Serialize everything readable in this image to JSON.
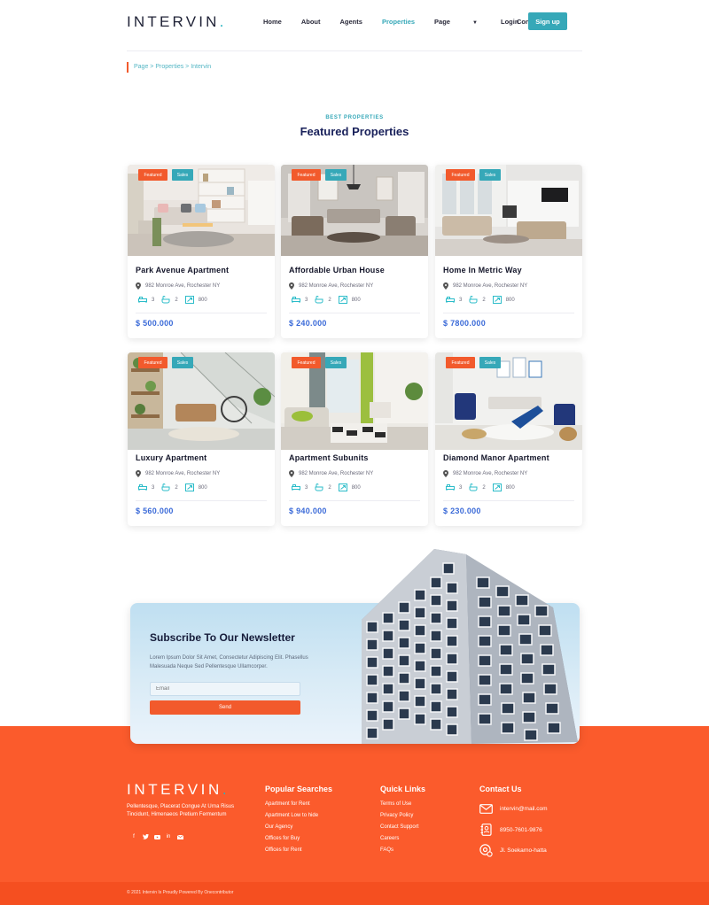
{
  "header": {
    "logo": "INTERVIN",
    "logo_dot": ".",
    "nav": [
      "Home",
      "About",
      "Agents",
      "Properties",
      "Page",
      "Contact Us"
    ],
    "active_nav": "Properties",
    "login": "Login",
    "signup": "Sign up"
  },
  "breadcrumb": "Page > Properties > Intervin",
  "section": {
    "eyebrow": "BEST PROPERTIES",
    "title": "Featured Properties"
  },
  "tags": {
    "featured": "Featured",
    "sales": "Sales"
  },
  "properties": [
    {
      "name": "Park Avenue Apartment",
      "address": "982 Monroe Ave, Rochester NY",
      "beds": "3",
      "baths": "2",
      "area": "800",
      "price": "$ 500.000"
    },
    {
      "name": "Affordable Urban House",
      "address": "982 Monroe Ave, Rochester NY",
      "beds": "3",
      "baths": "2",
      "area": "800",
      "price": "$ 240.000"
    },
    {
      "name": "Home In Metric Way",
      "address": "982 Monroe Ave, Rochester NY",
      "beds": "3",
      "baths": "2",
      "area": "800",
      "price": "$ 7800.000"
    },
    {
      "name": "Luxury Apartment",
      "address": "982 Monroe Ave, Rochester NY",
      "beds": "3",
      "baths": "2",
      "area": "800",
      "price": "$ 560.000"
    },
    {
      "name": "Apartment Subunits",
      "address": "982 Monroe Ave, Rochester NY",
      "beds": "3",
      "baths": "2",
      "area": "800",
      "price": "$ 940.000"
    },
    {
      "name": "Diamond Manor Apartment",
      "address": "982 Monroe Ave, Rochester NY",
      "beds": "3",
      "baths": "2",
      "area": "800",
      "price": "$ 230.000"
    }
  ],
  "newsletter": {
    "title": "Subscribe To Our Newsletter",
    "text": "Lorem Ipsum Dolor Sit Amet, Consectetur Adipiscing Elit. Phasellus Malesuada Neque Sed Pellentesque Ullamcorper.",
    "email_placeholder": "Email",
    "send": "Send"
  },
  "footer": {
    "logo": "INTERVIN",
    "logo_dot": ".",
    "description": "Pellentesque, Placerat Congue At Urna Risus Tincidunt, Himenaeos Pretium Fermentum",
    "social": [
      "facebook",
      "twitter",
      "youtube",
      "linkedin",
      "mail"
    ],
    "popular_title": "Popular Searches",
    "popular": [
      "Apartment for Rent",
      "Apartment Low to hide",
      "Our Agency",
      "Offices for Buy",
      "Offices for Rent"
    ],
    "quick_title": "Quick Links",
    "quick": [
      "Terms of Use",
      "Privacy Policy",
      "Contact Support",
      "Careers",
      "FAQs"
    ],
    "contact_title": "Contact Us",
    "email": "intervin@mail.com",
    "phone": "8950-7601-9876",
    "address": "Jl. Soekarno-hatta",
    "copyright": "© 2021 Intervin Is Proudly Powered By Onecontributor"
  },
  "colors": {
    "accent": "#36a8b8",
    "orange": "#fb5b2c",
    "navy": "#18205a",
    "price": "#3a6ad8"
  }
}
